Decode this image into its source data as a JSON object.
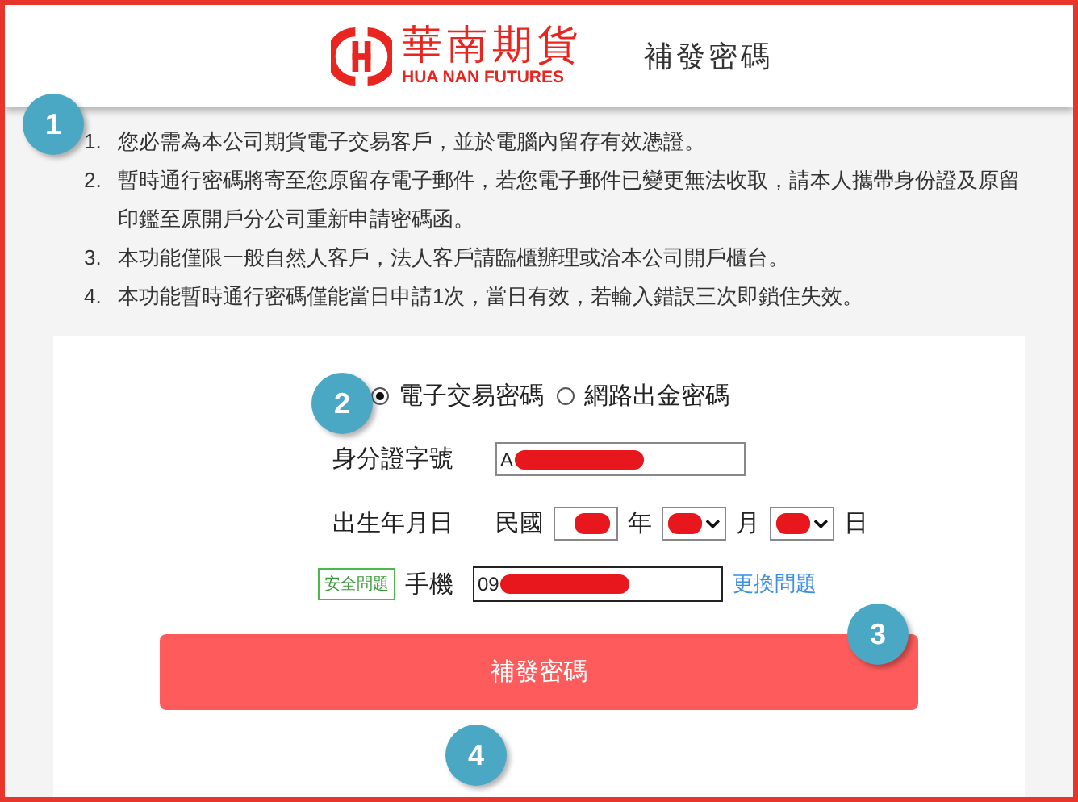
{
  "header": {
    "logo_name": "華南期貨",
    "logo_subtitle": "HUA NAN FUTURES",
    "title": "補發密碼"
  },
  "notes": [
    {
      "number": "1.",
      "text": "您必需為本公司期貨電子交易客戶，並於電腦內留存有效憑證。"
    },
    {
      "number": "2.",
      "text": "暫時通行密碼將寄至您原留存電子郵件，若您電子郵件已變更無法收取，請本人攜帶身份證及原留印鑑至原開戶分公司重新申請密碼函。"
    },
    {
      "number": "3.",
      "text": "本功能僅限一般自然人客戶，法人客戶請臨櫃辦理或洽本公司開戶櫃台。"
    },
    {
      "number": "4.",
      "text": "本功能暫時通行密碼僅能當日申請1次，當日有效，若輸入錯誤三次即鎖住失效。"
    }
  ],
  "password_types": [
    {
      "label": "電子交易密碼",
      "selected": true
    },
    {
      "label": "網路出金密碼",
      "selected": false
    }
  ],
  "id_field": {
    "label": "身分證字號",
    "value": "A",
    "redacted": true
  },
  "birth_date": {
    "label": "出生年月日",
    "era": "民國",
    "year_redacted": true,
    "year_unit": "年",
    "month_redacted": true,
    "month_unit": "月",
    "day_redacted": true,
    "day_unit": "日"
  },
  "security": {
    "tag": "安全問題",
    "label": "手機",
    "value": "09",
    "redacted": true,
    "change_link": "更換問題"
  },
  "submit_button": "補發密碼",
  "callouts": [
    {
      "number": "1"
    },
    {
      "number": "2"
    },
    {
      "number": "3"
    },
    {
      "number": "4"
    }
  ]
}
